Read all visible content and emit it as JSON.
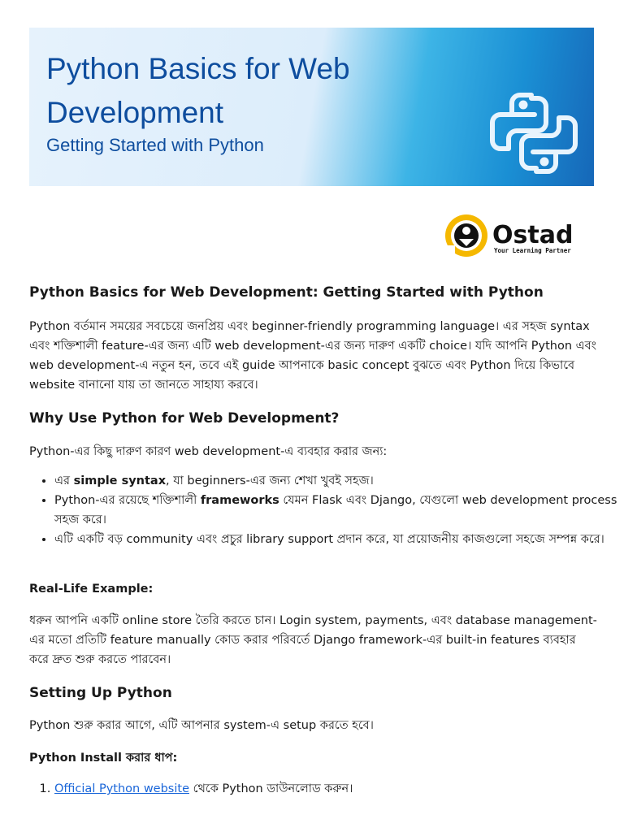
{
  "banner": {
    "title": "Python Basics for Web Development",
    "subtitle": "Getting Started with Python"
  },
  "logo": {
    "brand": "Ostad",
    "tagline": "Your Learning Partner"
  },
  "main": {
    "heading1": "Python Basics for Web Development: Getting Started with Python",
    "intro": "Python বর্তমান সময়ের সবচেয়ে জনপ্রিয় এবং beginner-friendly programming language। এর সহজ syntax এবং শক্তিশালী feature-এর জন্য এটি web development-এর জন্য দারুণ একটি choice। যদি আপনি Python এবং web development-এ নতুন হন, তবে এই guide আপনাকে basic concept বুঝতে এবং Python দিয়ে কিভাবে website বানানো যায় তা জানতে সাহায্য করবে।",
    "heading2": "Why Use Python for Web Development?",
    "why_intro": "Python-এর কিছু দারুণ কারণ web development-এ ব্যবহার করার জন্য:",
    "bullets": [
      {
        "pre": "এর ",
        "bold": "simple syntax",
        "post": ", যা beginners-এর জন্য শেখা খুবই সহজ।"
      },
      {
        "pre": "Python-এর রয়েছে শক্তিশালী ",
        "bold": "frameworks",
        "post": " যেমন Flask এবং Django, যেগুলো web development process সহজ করে।"
      },
      {
        "pre": "এটি একটি বড় community এবং প্রচুর library support প্রদান করে, যা প্রয়োজনীয় কাজগুলো সহজে সম্পন্ন করে।",
        "bold": "",
        "post": ""
      }
    ],
    "example_label": "Real-Life Example:",
    "example_text": "ধরুন আপনি একটি online store তৈরি করতে চান। Login system, payments, এবং database management-এর মতো প্রতিটি feature manually কোড করার পরিবর্তে Django framework-এর built-in features ব্যবহার করে দ্রুত শুরু করতে পারবেন।",
    "heading3": "Setting Up Python",
    "setup_intro": "Python শুরু করার আগে, এটি আপনার system-এ setup করতে হবে।",
    "steps_label": "Python Install করার ধাপ:",
    "steps": [
      {
        "link": "Official Python website",
        "text": " থেকে Python ডাউনলোড করুন।"
      }
    ]
  },
  "colors": {
    "title": "#0e4d9e",
    "link": "#1a66d9",
    "ostad_yellow": "#f5b800"
  }
}
